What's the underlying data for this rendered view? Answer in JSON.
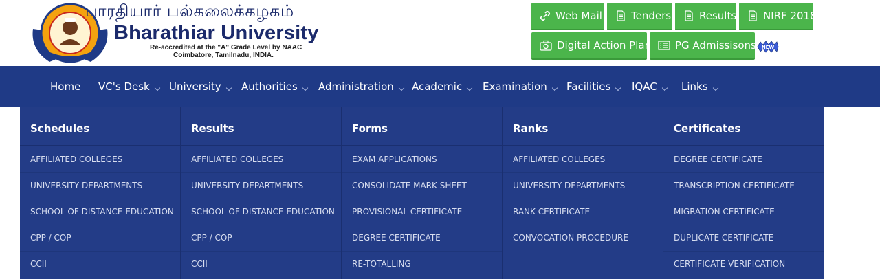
{
  "header": {
    "tamil_title": "பாரதியார் பல்கலைக்கழகம்",
    "english_title": "Bharathiar University",
    "subtitle_line1": "Re-accredited at the \"A\" Grade Level by NAAC",
    "subtitle_line2": "Coimbatore, Tamilnadu, INDIA."
  },
  "top_buttons": [
    {
      "label": "Web Mail",
      "icon": "link-icon"
    },
    {
      "label": "Tenders",
      "icon": "document-icon"
    },
    {
      "label": "Results",
      "icon": "document-icon"
    },
    {
      "label": "NIRF 2018",
      "icon": "document-icon"
    },
    {
      "label": "Digital Action Plan",
      "icon": "camera-icon"
    },
    {
      "label": "PG Admissisons",
      "icon": "list-icon"
    }
  ],
  "badge": {
    "label": "NEW"
  },
  "nav": {
    "items": [
      {
        "label": "Home",
        "dropdown": false
      },
      {
        "label": "VC's Desk",
        "dropdown": true
      },
      {
        "label": "University",
        "dropdown": true
      },
      {
        "label": "Authorities",
        "dropdown": true
      },
      {
        "label": "Administration",
        "dropdown": true
      },
      {
        "label": "Academic",
        "dropdown": true
      },
      {
        "label": "Examination",
        "dropdown": true
      },
      {
        "label": "Facilities",
        "dropdown": true
      },
      {
        "label": "IQAC",
        "dropdown": true
      },
      {
        "label": "Links",
        "dropdown": true
      }
    ]
  },
  "mega_menu": {
    "columns": [
      {
        "heading": "Schedules",
        "links": [
          "AFFILIATED COLLEGES",
          "UNIVERSITY DEPARTMENTS",
          "SCHOOL OF DISTANCE EDUCATION",
          "CPP / COP",
          "CCII"
        ]
      },
      {
        "heading": "Results",
        "links": [
          "AFFILIATED COLLEGES",
          "UNIVERSITY DEPARTMENTS",
          "SCHOOL OF DISTANCE EDUCATION",
          "CPP / COP",
          "CCII"
        ]
      },
      {
        "heading": "Forms",
        "links": [
          "EXAM APPLICATIONS",
          "CONSOLIDATE MARK SHEET",
          "PROVISIONAL CERTIFICATE",
          "DEGREE CERTIFICATE",
          "RE-TOTALLING"
        ]
      },
      {
        "heading": "Ranks",
        "links": [
          "AFFILIATED COLLEGES",
          "UNIVERSITY DEPARTMENTS",
          "RANK CERTIFICATE",
          "CONVOCATION PROCEDURE"
        ]
      },
      {
        "heading": "Certificates",
        "links": [
          "DEGREE CERTIFICATE",
          "TRANSCRIPTION CERTIFICATE",
          "MIGRATION CERTIFICATE",
          "DUPLICATE CERTIFICATE",
          "CERTIFICATE VERIFICATION"
        ]
      }
    ]
  },
  "colors": {
    "nav_bg": "#1f3a86",
    "menu_bg": "#233c87",
    "button_green": "#4bb54b",
    "title_blue": "#1b2a6b"
  }
}
